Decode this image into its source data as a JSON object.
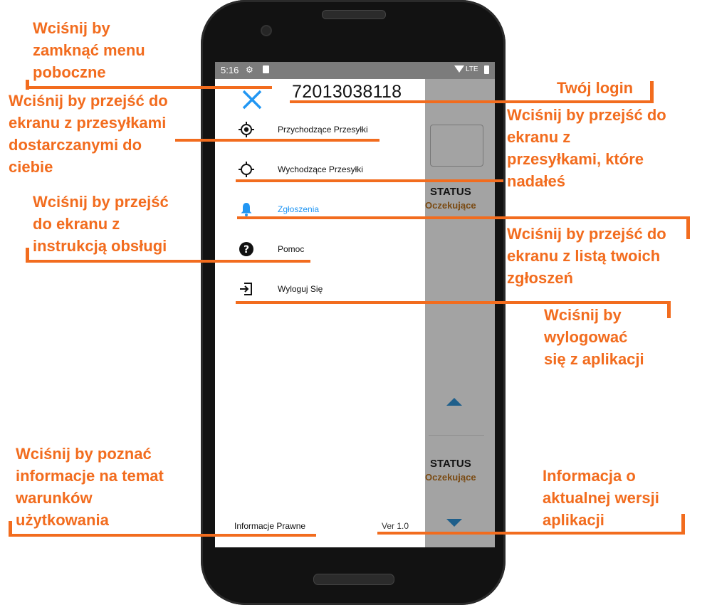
{
  "status_bar": {
    "time": "5:16",
    "network": "LTE"
  },
  "drawer": {
    "login": "72013038118",
    "menu": [
      {
        "label": "Przychodzące Przesyłki",
        "icon": "target-crosshair-icon",
        "active": false
      },
      {
        "label": "Wychodzące Przesyłki",
        "icon": "crosshair-icon",
        "active": false
      },
      {
        "label": "Zgłoszenia",
        "icon": "bell-icon",
        "active": true
      },
      {
        "label": "Pomoc",
        "icon": "help-circle-icon",
        "active": false
      },
      {
        "label": "Wyloguj Się",
        "icon": "logout-icon",
        "active": false
      }
    ],
    "footer": {
      "legal": "Informacje Prawne",
      "version": "Ver 1.0"
    }
  },
  "background_app": {
    "status_label_1": "STATUS",
    "status_value_1": "Oczekujące",
    "status_label_2": "STATUS",
    "status_value_2": "Oczekujące"
  },
  "annotations": {
    "close_menu": "Wciśnij by\nzamknąć menu\npoboczne",
    "incoming": "Wciśnij by przejść do\nekranu z przesyłkami\ndostarczanymi do\nciebie",
    "help": "Wciśnij by przejść\ndo ekranu z\ninstrukcją obsługi",
    "legal": "Wciśnij by poznać\ninformacje na temat\nwarunków\nużytkowania",
    "login": "Twój login",
    "outgoing": "Wciśnij by przejść do\nekranu z\nprzesyłkami, które\nnadałeś",
    "reports": "Wciśnij by przejść do\nekranu z listą twoich\nzgłoszeń",
    "logout": "Wciśnij by\nwylogować\nsię z aplikacji",
    "version": "Informacja o\naktualnej wersji\naplikacji"
  },
  "colors": {
    "accent": "#2196f3",
    "annotation": "#f26c1e",
    "status_value": "#7a4a12"
  }
}
